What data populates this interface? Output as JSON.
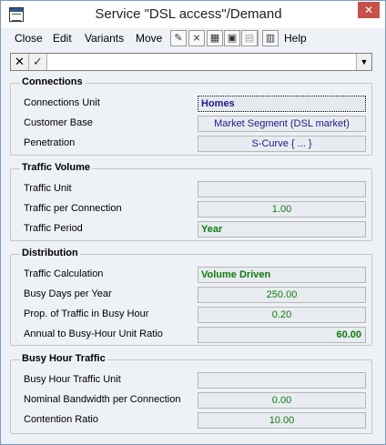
{
  "window": {
    "title": "Service \"DSL access\"/Demand",
    "close_glyph": "✕"
  },
  "menubar": {
    "items": [
      "Close",
      "Edit",
      "Variants",
      "Move",
      "Help"
    ],
    "toolbar_icons": [
      "edit-icon",
      "chart-icon",
      "grid-icon",
      "grid-search-icon",
      "grid-dim-icon",
      "clipboard-icon"
    ]
  },
  "editbar": {
    "cancel_glyph": "✕",
    "accept_glyph": "✓",
    "dropdown_glyph": "▼",
    "value": ""
  },
  "sections": {
    "connections": {
      "title": "Connections",
      "rows": [
        {
          "label": "Connections Unit",
          "value": "Homes"
        },
        {
          "label": "Customer Base",
          "value": "Market Segment (DSL market)"
        },
        {
          "label": "Penetration",
          "value": "S-Curve { ... }"
        }
      ]
    },
    "traffic_volume": {
      "title": "Traffic Volume",
      "rows": [
        {
          "label": "Traffic Unit",
          "value": ""
        },
        {
          "label": "Traffic per Connection",
          "value": "1.00"
        },
        {
          "label": "Traffic Period",
          "value": "Year"
        }
      ]
    },
    "distribution": {
      "title": "Distribution",
      "rows": [
        {
          "label": "Traffic Calculation",
          "value": "Volume Driven"
        },
        {
          "label": "Busy Days per Year",
          "value": "250.00"
        },
        {
          "label": "Prop. of Traffic in Busy Hour",
          "value": "0.20"
        },
        {
          "label": "Annual to Busy-Hour Unit Ratio",
          "value": "60.00"
        }
      ]
    },
    "busy_hour": {
      "title": "Busy Hour Traffic",
      "rows": [
        {
          "label": "Busy Hour Traffic Unit",
          "value": ""
        },
        {
          "label": "Nominal Bandwidth per Connection",
          "value": "0.00"
        },
        {
          "label": "Contention Ratio",
          "value": "10.00"
        }
      ]
    }
  },
  "colors": {
    "blue_text": "#1a1a8c",
    "green_text": "#0f7a0f",
    "close_button": "#c7504a"
  }
}
